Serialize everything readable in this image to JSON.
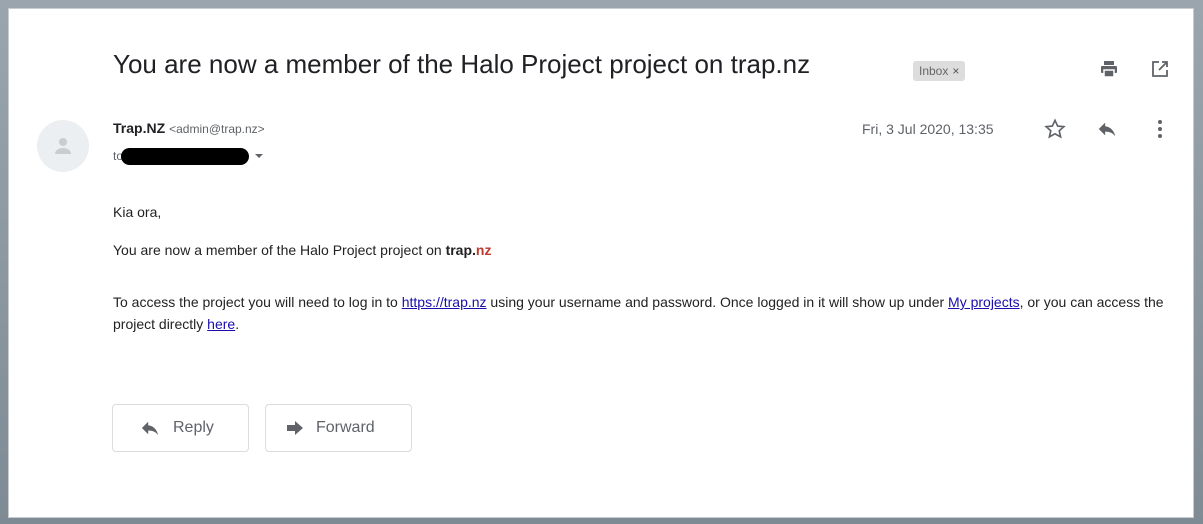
{
  "subject": "You are now a member of the Halo Project project on trap.nz",
  "label": {
    "name": "Inbox",
    "remove": "×"
  },
  "sender": {
    "name": "Trap.NZ",
    "email": "<admin@trap.nz>"
  },
  "recipient": {
    "to_label": "to"
  },
  "date": "Fri, 3 Jul 2020, 13:35",
  "body": {
    "greeting": "Kia ora,",
    "line1_prefix": "You are now a member of the Halo Project project on ",
    "brand_trap": "trap.",
    "brand_nz": "nz",
    "line2_prefix": "To access the project you will need to log in to ",
    "link_site": "https://trap.nz",
    "line2_middle": " using your username and password. Once logged in it will show up under ",
    "link_projects": "My projects",
    "line2_after": ", or you can access the project directly ",
    "link_here": "here",
    "line2_end": "."
  },
  "actions": {
    "reply": "Reply",
    "forward": "Forward"
  },
  "icons": [
    "print-icon",
    "open-in-new-window-icon",
    "avatar-person-icon",
    "star-icon",
    "reply-icon",
    "more-vert-icon",
    "chevron-down-icon",
    "forward-icon"
  ]
}
